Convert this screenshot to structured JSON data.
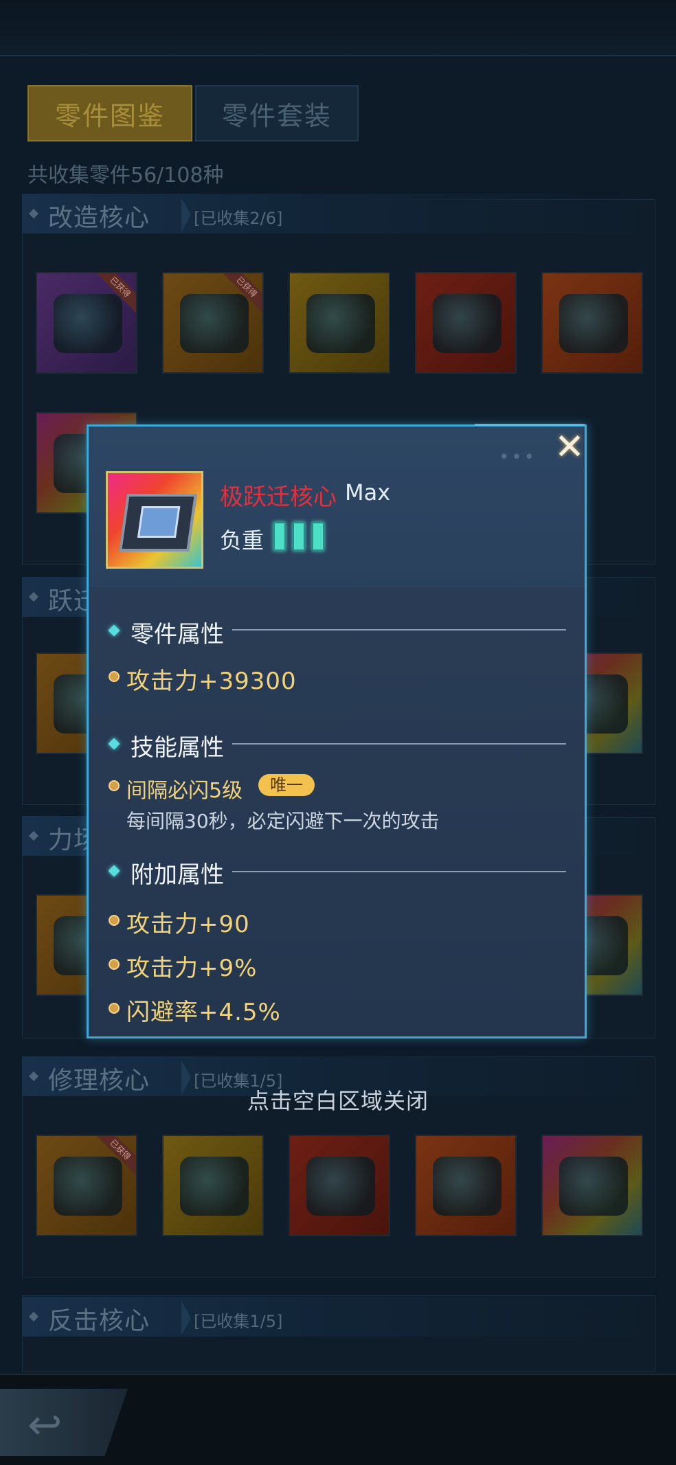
{
  "tabs": [
    {
      "label": "零件图鉴",
      "active": true
    },
    {
      "label": "零件套装",
      "active": false
    }
  ],
  "collection_total": "共收集零件56/108种",
  "sections": [
    {
      "title": "改造核心",
      "count": "[已收集2/6]"
    },
    {
      "title": "跃迁核心",
      "count": ""
    },
    {
      "title": "力场核心",
      "count": ""
    },
    {
      "title": "修理核心",
      "count": "[已收集1/5]"
    },
    {
      "title": "反击核心",
      "count": "[已收集1/5]"
    }
  ],
  "obtained_ribbon": "已获得",
  "close_hint": "点击空白区域关闭",
  "popup": {
    "item_name": "极跃迁核心",
    "level": "Max",
    "load_label": "负重",
    "load_bars": 3,
    "groups": {
      "part_attr": "零件属性",
      "skill_attr": "技能属性",
      "extra_attr": "附加属性"
    },
    "part_stats": [
      "攻击力+39300"
    ],
    "skill": {
      "name": "间隔必闪5级",
      "badge": "唯一",
      "description": "每间隔30秒，必定闪避下一次的攻击"
    },
    "extra_stats": [
      "攻击力+90",
      "攻击力+9%",
      "闪避率+4.5%"
    ],
    "close_icon": "close-x-icon"
  },
  "colors": {
    "popup_border": "#3fa9d8",
    "item_name": "#e4303d",
    "stat_text": "#f2d379",
    "load_bar": "#4be0c7"
  }
}
